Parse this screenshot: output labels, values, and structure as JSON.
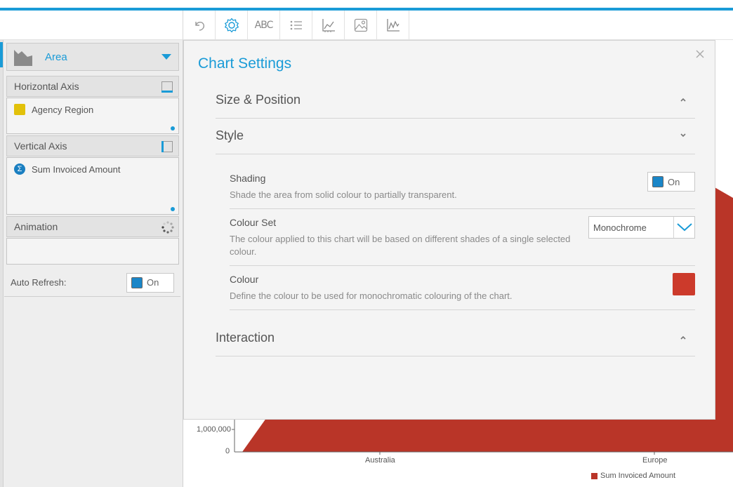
{
  "toolbar": {
    "abc_label": "ABC",
    "items": [
      "undo",
      "settings",
      "labels",
      "legend",
      "axes",
      "background",
      "series"
    ]
  },
  "sidebar": {
    "chart_type": "Area",
    "horizontal_axis": {
      "title": "Horizontal Axis",
      "field": "Agency Region"
    },
    "vertical_axis": {
      "title": "Vertical Axis",
      "field": "Sum Invoiced Amount"
    },
    "animation": {
      "title": "Animation"
    },
    "auto_refresh": {
      "label": "Auto Refresh:",
      "state": "On"
    }
  },
  "modal": {
    "title": "Chart Settings",
    "sections": {
      "size_position": "Size & Position",
      "style": "Style",
      "interaction": "Interaction"
    },
    "settings": {
      "shading": {
        "name": "Shading",
        "description": "Shade the area from solid colour to partially transparent.",
        "state": "On"
      },
      "colour_set": {
        "name": "Colour Set",
        "description": "The colour applied to this chart will be based on different shades of a single selected colour.",
        "value": "Monochrome"
      },
      "colour": {
        "name": "Colour",
        "description": "Define the colour to be used for monochromatic colouring of the chart.",
        "value": "#cc3a2b"
      }
    }
  },
  "chart_data": {
    "type": "area",
    "categories": [
      "Australia",
      "Europe"
    ],
    "y_ticks": [
      "0",
      "1,000,000"
    ],
    "series": [
      {
        "name": "Sum Invoiced Amount"
      }
    ]
  },
  "colors": {
    "accent": "#1a9bd7",
    "series": "#b93528"
  }
}
